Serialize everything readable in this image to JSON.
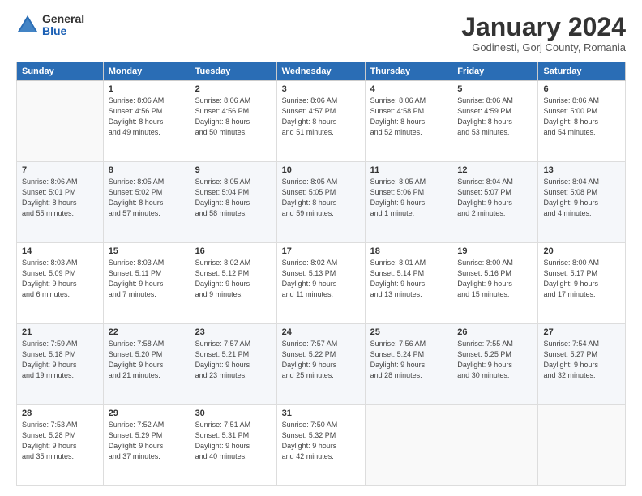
{
  "logo": {
    "general": "General",
    "blue": "Blue"
  },
  "header": {
    "month": "January 2024",
    "location": "Godinesti, Gorj County, Romania"
  },
  "days_of_week": [
    "Sunday",
    "Monday",
    "Tuesday",
    "Wednesday",
    "Thursday",
    "Friday",
    "Saturday"
  ],
  "weeks": [
    [
      {
        "day": "",
        "info": ""
      },
      {
        "day": "1",
        "info": "Sunrise: 8:06 AM\nSunset: 4:56 PM\nDaylight: 8 hours\nand 49 minutes."
      },
      {
        "day": "2",
        "info": "Sunrise: 8:06 AM\nSunset: 4:56 PM\nDaylight: 8 hours\nand 50 minutes."
      },
      {
        "day": "3",
        "info": "Sunrise: 8:06 AM\nSunset: 4:57 PM\nDaylight: 8 hours\nand 51 minutes."
      },
      {
        "day": "4",
        "info": "Sunrise: 8:06 AM\nSunset: 4:58 PM\nDaylight: 8 hours\nand 52 minutes."
      },
      {
        "day": "5",
        "info": "Sunrise: 8:06 AM\nSunset: 4:59 PM\nDaylight: 8 hours\nand 53 minutes."
      },
      {
        "day": "6",
        "info": "Sunrise: 8:06 AM\nSunset: 5:00 PM\nDaylight: 8 hours\nand 54 minutes."
      }
    ],
    [
      {
        "day": "7",
        "info": "Sunrise: 8:06 AM\nSunset: 5:01 PM\nDaylight: 8 hours\nand 55 minutes."
      },
      {
        "day": "8",
        "info": "Sunrise: 8:05 AM\nSunset: 5:02 PM\nDaylight: 8 hours\nand 57 minutes."
      },
      {
        "day": "9",
        "info": "Sunrise: 8:05 AM\nSunset: 5:04 PM\nDaylight: 8 hours\nand 58 minutes."
      },
      {
        "day": "10",
        "info": "Sunrise: 8:05 AM\nSunset: 5:05 PM\nDaylight: 8 hours\nand 59 minutes."
      },
      {
        "day": "11",
        "info": "Sunrise: 8:05 AM\nSunset: 5:06 PM\nDaylight: 9 hours\nand 1 minute."
      },
      {
        "day": "12",
        "info": "Sunrise: 8:04 AM\nSunset: 5:07 PM\nDaylight: 9 hours\nand 2 minutes."
      },
      {
        "day": "13",
        "info": "Sunrise: 8:04 AM\nSunset: 5:08 PM\nDaylight: 9 hours\nand 4 minutes."
      }
    ],
    [
      {
        "day": "14",
        "info": "Sunrise: 8:03 AM\nSunset: 5:09 PM\nDaylight: 9 hours\nand 6 minutes."
      },
      {
        "day": "15",
        "info": "Sunrise: 8:03 AM\nSunset: 5:11 PM\nDaylight: 9 hours\nand 7 minutes."
      },
      {
        "day": "16",
        "info": "Sunrise: 8:02 AM\nSunset: 5:12 PM\nDaylight: 9 hours\nand 9 minutes."
      },
      {
        "day": "17",
        "info": "Sunrise: 8:02 AM\nSunset: 5:13 PM\nDaylight: 9 hours\nand 11 minutes."
      },
      {
        "day": "18",
        "info": "Sunrise: 8:01 AM\nSunset: 5:14 PM\nDaylight: 9 hours\nand 13 minutes."
      },
      {
        "day": "19",
        "info": "Sunrise: 8:00 AM\nSunset: 5:16 PM\nDaylight: 9 hours\nand 15 minutes."
      },
      {
        "day": "20",
        "info": "Sunrise: 8:00 AM\nSunset: 5:17 PM\nDaylight: 9 hours\nand 17 minutes."
      }
    ],
    [
      {
        "day": "21",
        "info": "Sunrise: 7:59 AM\nSunset: 5:18 PM\nDaylight: 9 hours\nand 19 minutes."
      },
      {
        "day": "22",
        "info": "Sunrise: 7:58 AM\nSunset: 5:20 PM\nDaylight: 9 hours\nand 21 minutes."
      },
      {
        "day": "23",
        "info": "Sunrise: 7:57 AM\nSunset: 5:21 PM\nDaylight: 9 hours\nand 23 minutes."
      },
      {
        "day": "24",
        "info": "Sunrise: 7:57 AM\nSunset: 5:22 PM\nDaylight: 9 hours\nand 25 minutes."
      },
      {
        "day": "25",
        "info": "Sunrise: 7:56 AM\nSunset: 5:24 PM\nDaylight: 9 hours\nand 28 minutes."
      },
      {
        "day": "26",
        "info": "Sunrise: 7:55 AM\nSunset: 5:25 PM\nDaylight: 9 hours\nand 30 minutes."
      },
      {
        "day": "27",
        "info": "Sunrise: 7:54 AM\nSunset: 5:27 PM\nDaylight: 9 hours\nand 32 minutes."
      }
    ],
    [
      {
        "day": "28",
        "info": "Sunrise: 7:53 AM\nSunset: 5:28 PM\nDaylight: 9 hours\nand 35 minutes."
      },
      {
        "day": "29",
        "info": "Sunrise: 7:52 AM\nSunset: 5:29 PM\nDaylight: 9 hours\nand 37 minutes."
      },
      {
        "day": "30",
        "info": "Sunrise: 7:51 AM\nSunset: 5:31 PM\nDaylight: 9 hours\nand 40 minutes."
      },
      {
        "day": "31",
        "info": "Sunrise: 7:50 AM\nSunset: 5:32 PM\nDaylight: 9 hours\nand 42 minutes."
      },
      {
        "day": "",
        "info": ""
      },
      {
        "day": "",
        "info": ""
      },
      {
        "day": "",
        "info": ""
      }
    ]
  ]
}
